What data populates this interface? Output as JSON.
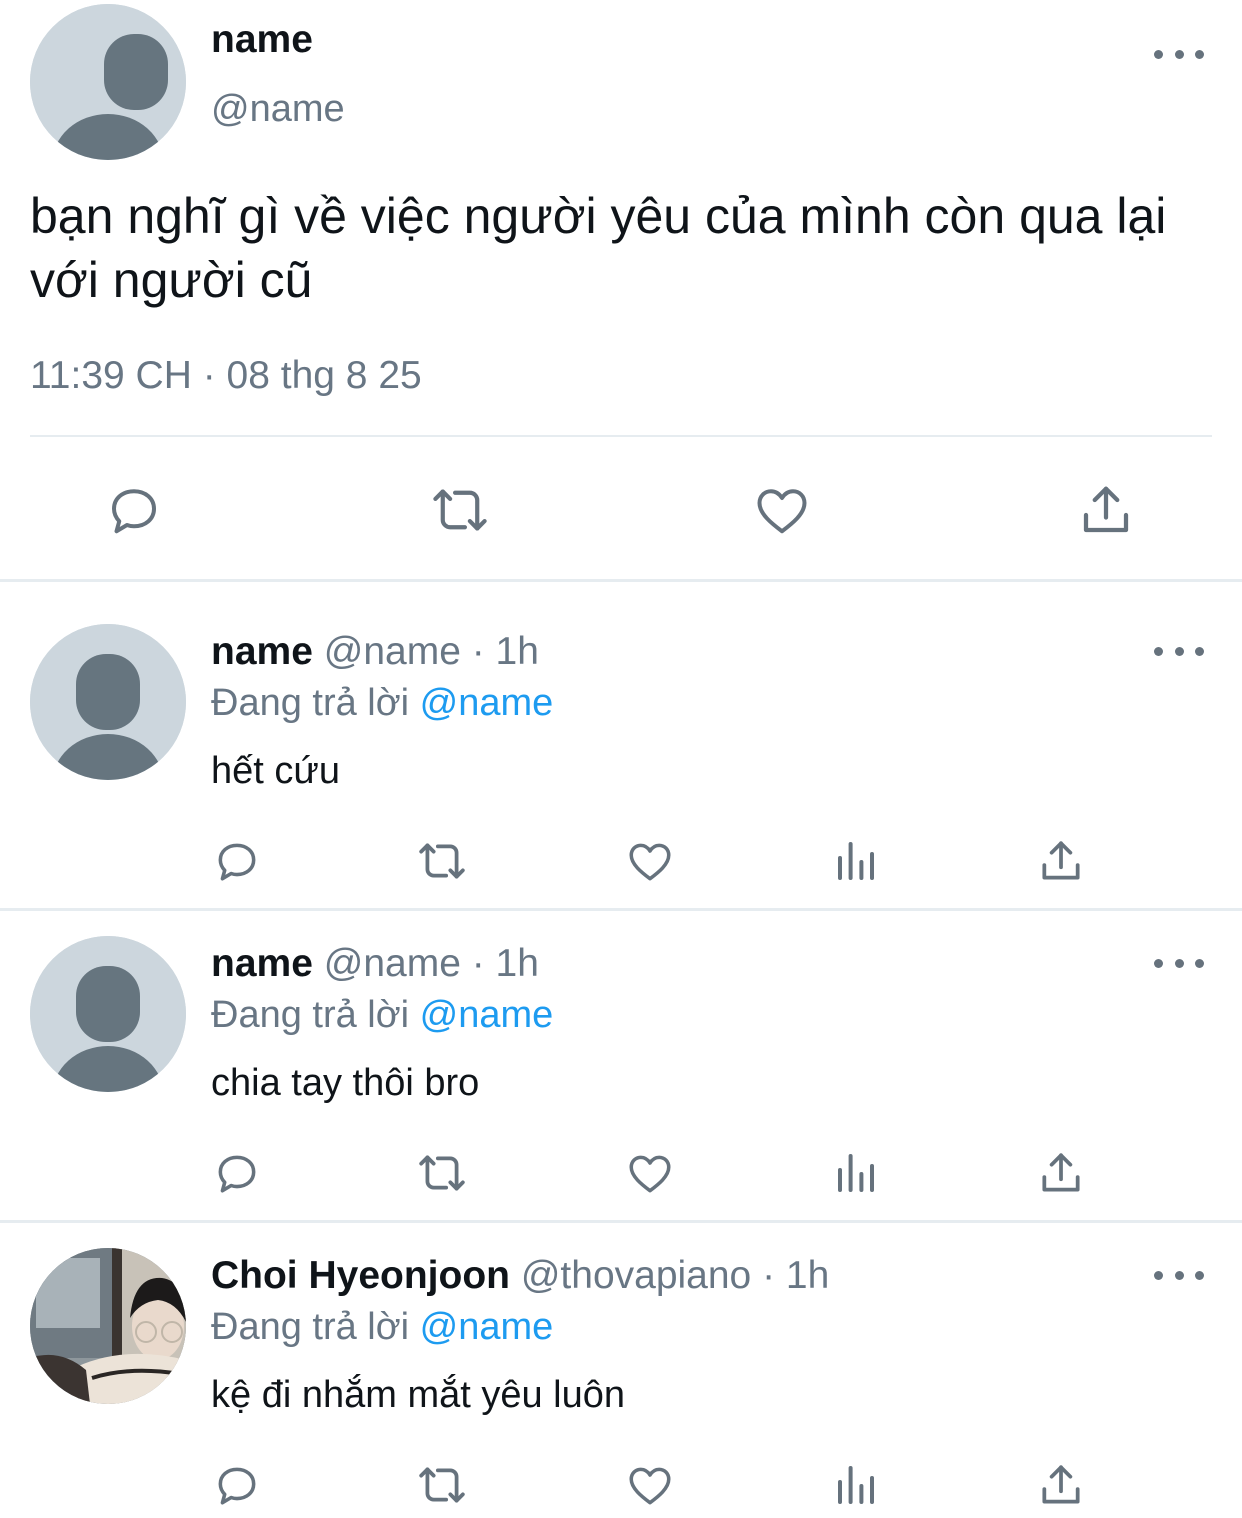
{
  "tweet": {
    "name": "name",
    "handle": "@name",
    "text": "bạn nghĩ gì về việc người yêu của mình còn qua lại với người cũ",
    "timestamp": "11:39 CH · 08 thg 8 25",
    "actions": [
      "reply-icon",
      "retweet-icon",
      "like-icon",
      "share-icon"
    ]
  },
  "replies": [
    {
      "name": "name",
      "meta": "@name · 1h",
      "replying_label": "Đang trả lời",
      "replying_to": "@name",
      "text": "hết cứu"
    },
    {
      "name": "name",
      "meta": "@name · 1h",
      "replying_label": "Đang trả lời",
      "replying_to": "@name",
      "text": "chia tay thôi bro"
    },
    {
      "name": "Choi Hyeonjoon",
      "meta": "@thovapiano · 1h",
      "replying_label": "Đang trả lời",
      "replying_to": "@name",
      "text": "kệ đi nhắm mắt yêu luôn"
    }
  ],
  "reply_actions": [
    "reply-icon",
    "retweet-icon",
    "like-icon",
    "analytics-icon",
    "share-icon"
  ],
  "colors": {
    "text": "#0f1419",
    "muted": "#687684",
    "link": "#1d9bf0",
    "icon": "#66727d",
    "divider": "#e6ecf0"
  }
}
